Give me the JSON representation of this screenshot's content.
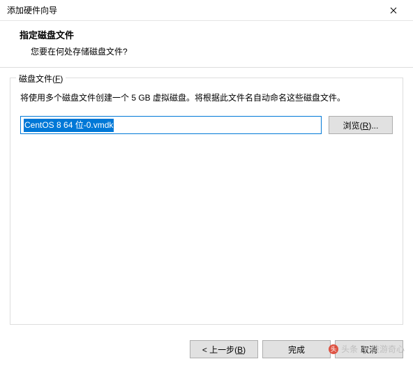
{
  "window": {
    "title": "添加硬件向导"
  },
  "header": {
    "title": "指定磁盘文件",
    "subtitle": "您要在何处存储磁盘文件?"
  },
  "group": {
    "legend_prefix": "磁盘文件(",
    "legend_key": "F",
    "legend_suffix": ")",
    "description": "将使用多个磁盘文件创建一个 5 GB 虚拟磁盘。将根据此文件名自动命名这些磁盘文件。",
    "file_value": "CentOS 8 64 位-0.vmdk",
    "browse_prefix": "浏览(",
    "browse_key": "R",
    "browse_suffix": ")..."
  },
  "footer": {
    "back_prefix": "< 上一步(",
    "back_key": "B",
    "back_suffix": ")",
    "finish": "完成",
    "cancel": "取消"
  },
  "watermark": {
    "text": "头条 @ 技游奇心"
  }
}
